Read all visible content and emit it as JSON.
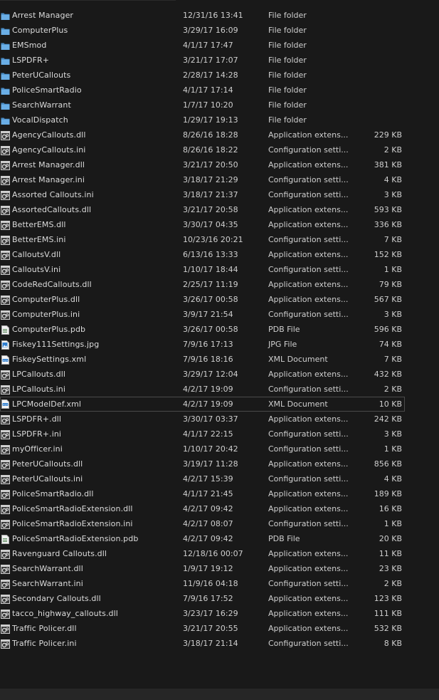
{
  "files": [
    {
      "name": "Arrest Manager",
      "date": "12/31/16 13:41",
      "type": "File folder",
      "size": "",
      "icon": "folder-icon"
    },
    {
      "name": "ComputerPlus",
      "date": "3/29/17 16:09",
      "type": "File folder",
      "size": "",
      "icon": "folder-icon"
    },
    {
      "name": "EMSmod",
      "date": "4/1/17 17:47",
      "type": "File folder",
      "size": "",
      "icon": "folder-icon"
    },
    {
      "name": "LSPDFR+",
      "date": "3/21/17 17:07",
      "type": "File folder",
      "size": "",
      "icon": "folder-icon"
    },
    {
      "name": "PeterUCallouts",
      "date": "2/28/17 14:28",
      "type": "File folder",
      "size": "",
      "icon": "folder-icon"
    },
    {
      "name": "PoliceSmartRadio",
      "date": "4/1/17 17:14",
      "type": "File folder",
      "size": "",
      "icon": "folder-icon"
    },
    {
      "name": "SearchWarrant",
      "date": "1/7/17 10:20",
      "type": "File folder",
      "size": "",
      "icon": "folder-icon"
    },
    {
      "name": "VocalDispatch",
      "date": "1/29/17 19:13",
      "type": "File folder",
      "size": "",
      "icon": "folder-icon"
    },
    {
      "name": "AgencyCallouts.dll",
      "date": "8/26/16 18:28",
      "type": "Application extens...",
      "size": "229 KB",
      "icon": "gear-file-icon"
    },
    {
      "name": "AgencyCallouts.ini",
      "date": "8/26/16 18:22",
      "type": "Configuration setti...",
      "size": "2 KB",
      "icon": "gear-file-icon"
    },
    {
      "name": "Arrest Manager.dll",
      "date": "3/21/17 20:50",
      "type": "Application extens...",
      "size": "381 KB",
      "icon": "gear-file-icon"
    },
    {
      "name": "Arrest Manager.ini",
      "date": "3/18/17 21:29",
      "type": "Configuration setti...",
      "size": "4 KB",
      "icon": "gear-file-icon"
    },
    {
      "name": "Assorted Callouts.ini",
      "date": "3/18/17 21:37",
      "type": "Configuration setti...",
      "size": "3 KB",
      "icon": "gear-file-icon"
    },
    {
      "name": "AssortedCallouts.dll",
      "date": "3/21/17 20:58",
      "type": "Application extens...",
      "size": "593 KB",
      "icon": "gear-file-icon"
    },
    {
      "name": "BetterEMS.dll",
      "date": "3/30/17 04:35",
      "type": "Application extens...",
      "size": "336 KB",
      "icon": "gear-file-icon"
    },
    {
      "name": "BetterEMS.ini",
      "date": "10/23/16 20:21",
      "type": "Configuration setti...",
      "size": "7 KB",
      "icon": "gear-file-icon"
    },
    {
      "name": "CalloutsV.dll",
      "date": "6/13/16 13:33",
      "type": "Application extens...",
      "size": "152 KB",
      "icon": "gear-file-icon"
    },
    {
      "name": "CalloutsV.ini",
      "date": "1/10/17 18:44",
      "type": "Configuration setti...",
      "size": "1 KB",
      "icon": "gear-file-icon"
    },
    {
      "name": "CodeRedCallouts.dll",
      "date": "2/25/17 11:19",
      "type": "Application extens...",
      "size": "79 KB",
      "icon": "gear-file-icon"
    },
    {
      "name": "ComputerPlus.dll",
      "date": "3/26/17 00:58",
      "type": "Application extens...",
      "size": "567 KB",
      "icon": "gear-file-icon"
    },
    {
      "name": "ComputerPlus.ini",
      "date": "3/9/17 21:54",
      "type": "Configuration setti...",
      "size": "3 KB",
      "icon": "gear-file-icon"
    },
    {
      "name": "ComputerPlus.pdb",
      "date": "3/26/17 00:58",
      "type": "PDB File",
      "size": "596 KB",
      "icon": "document-file-icon"
    },
    {
      "name": "Fiskey111Settings.jpg",
      "date": "7/9/16 17:13",
      "type": "JPG File",
      "size": "74 KB",
      "icon": "image-file-icon"
    },
    {
      "name": "FiskeySettings.xml",
      "date": "7/9/16 18:16",
      "type": "XML Document",
      "size": "7 KB",
      "icon": "xml-file-icon"
    },
    {
      "name": "LPCallouts.dll",
      "date": "3/29/17 12:04",
      "type": "Application extens...",
      "size": "432 KB",
      "icon": "gear-file-icon"
    },
    {
      "name": "LPCallouts.ini",
      "date": "4/2/17 19:09",
      "type": "Configuration setti...",
      "size": "2 KB",
      "icon": "gear-file-icon"
    },
    {
      "name": "LPCModelDef.xml",
      "date": "4/2/17 19:09",
      "type": "XML Document",
      "size": "10 KB",
      "icon": "xml-file-icon",
      "selected": true
    },
    {
      "name": "LSPDFR+.dll",
      "date": "3/30/17 03:37",
      "type": "Application extens...",
      "size": "242 KB",
      "icon": "gear-file-icon"
    },
    {
      "name": "LSPDFR+.ini",
      "date": "4/1/17 22:15",
      "type": "Configuration setti...",
      "size": "3 KB",
      "icon": "gear-file-icon"
    },
    {
      "name": "myOfficer.ini",
      "date": "1/10/17 20:42",
      "type": "Configuration setti...",
      "size": "1 KB",
      "icon": "gear-file-icon"
    },
    {
      "name": "PeterUCallouts.dll",
      "date": "3/19/17 11:28",
      "type": "Application extens...",
      "size": "856 KB",
      "icon": "gear-file-icon"
    },
    {
      "name": "PeterUCallouts.ini",
      "date": "4/2/17 15:39",
      "type": "Configuration setti...",
      "size": "4 KB",
      "icon": "gear-file-icon"
    },
    {
      "name": "PoliceSmartRadio.dll",
      "date": "4/1/17 21:45",
      "type": "Application extens...",
      "size": "189 KB",
      "icon": "gear-file-icon"
    },
    {
      "name": "PoliceSmartRadioExtension.dll",
      "date": "4/2/17 09:42",
      "type": "Application extens...",
      "size": "16 KB",
      "icon": "gear-file-icon"
    },
    {
      "name": "PoliceSmartRadioExtension.ini",
      "date": "4/2/17 08:07",
      "type": "Configuration setti...",
      "size": "1 KB",
      "icon": "gear-file-icon"
    },
    {
      "name": "PoliceSmartRadioExtension.pdb",
      "date": "4/2/17 09:42",
      "type": "PDB File",
      "size": "20 KB",
      "icon": "document-file-icon"
    },
    {
      "name": "Ravenguard Callouts.dll",
      "date": "12/18/16 00:07",
      "type": "Application extens...",
      "size": "11 KB",
      "icon": "gear-file-icon"
    },
    {
      "name": "SearchWarrant.dll",
      "date": "1/9/17 19:12",
      "type": "Application extens...",
      "size": "23 KB",
      "icon": "gear-file-icon"
    },
    {
      "name": "SearchWarrant.ini",
      "date": "11/9/16 04:18",
      "type": "Configuration setti...",
      "size": "2 KB",
      "icon": "gear-file-icon"
    },
    {
      "name": "Secondary Callouts.dll",
      "date": "7/9/16 17:52",
      "type": "Application extens...",
      "size": "123 KB",
      "icon": "gear-file-icon"
    },
    {
      "name": "tacco_highway_callouts.dll",
      "date": "3/23/17 16:29",
      "type": "Application extens...",
      "size": "111 KB",
      "icon": "gear-file-icon"
    },
    {
      "name": "Traffic Policer.dll",
      "date": "3/21/17 20:55",
      "type": "Application extens...",
      "size": "532 KB",
      "icon": "gear-file-icon"
    },
    {
      "name": "Traffic Policer.ini",
      "date": "3/18/17 21:14",
      "type": "Configuration setti...",
      "size": "8 KB",
      "icon": "gear-file-icon"
    }
  ],
  "colors": {
    "background": "#191919",
    "text": "#d7d7d7",
    "folder": "#5b9bd5",
    "selection_border": "#4a4a4a"
  }
}
